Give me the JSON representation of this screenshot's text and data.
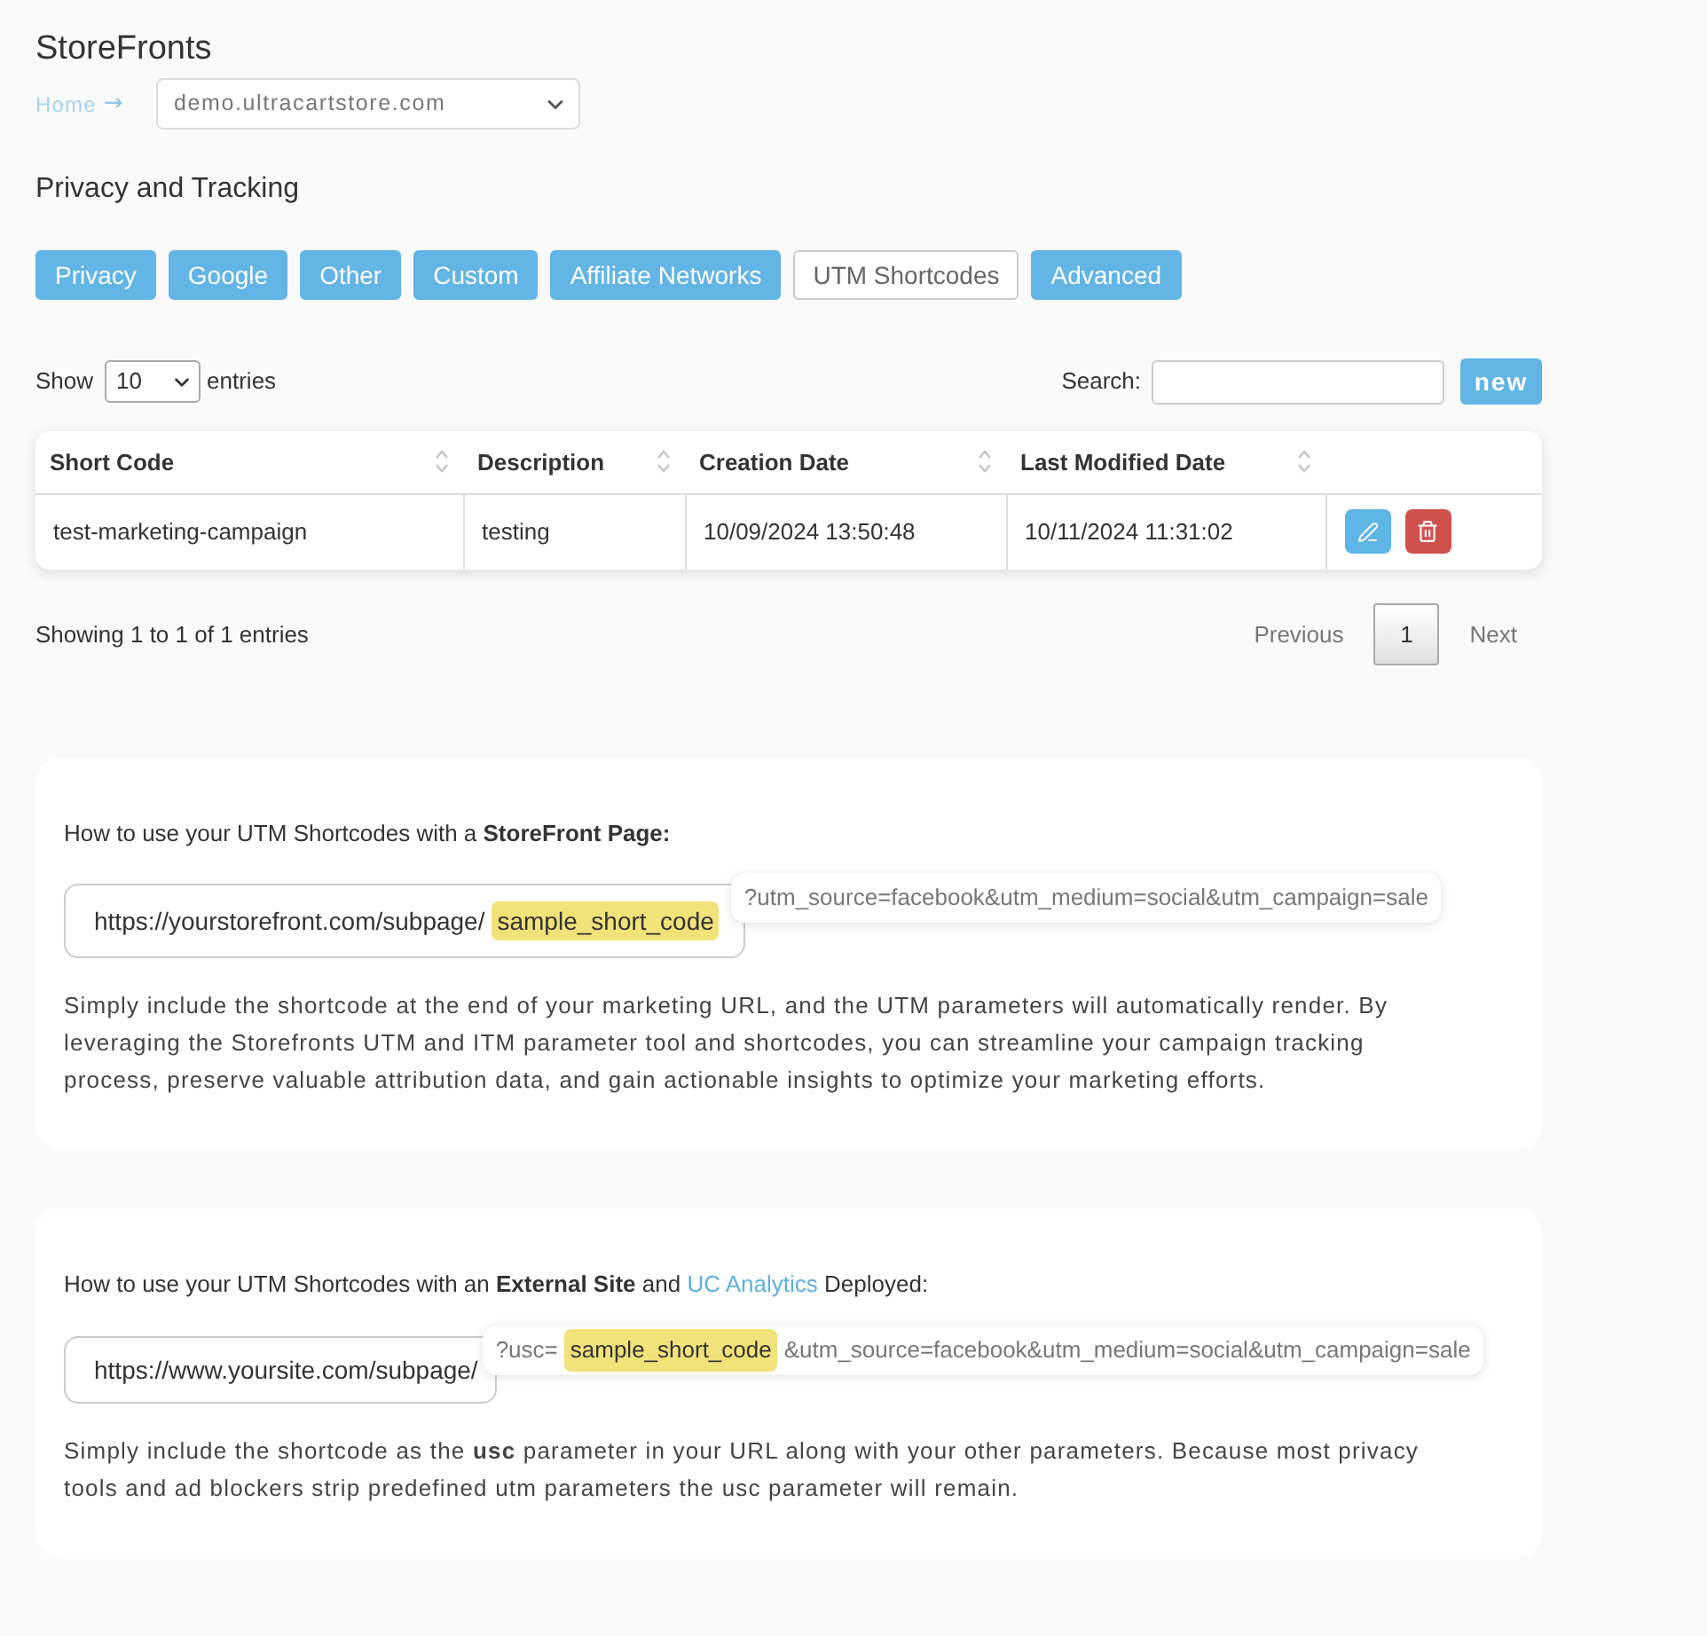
{
  "page": {
    "title": "StoreFronts"
  },
  "breadcrumb": {
    "home": "Home",
    "separator": "→",
    "store_select": {
      "value": "demo.ultracartstore.com"
    }
  },
  "section": {
    "title": "Privacy and Tracking"
  },
  "tabs": [
    {
      "label": "Privacy",
      "selected": false
    },
    {
      "label": "Google",
      "selected": false
    },
    {
      "label": "Other",
      "selected": false
    },
    {
      "label": "Custom",
      "selected": false
    },
    {
      "label": "Affiliate Networks",
      "selected": false
    },
    {
      "label": "UTM Shortcodes",
      "selected": true
    },
    {
      "label": "Advanced",
      "selected": false
    }
  ],
  "table_controls": {
    "show_label": "Show",
    "page_length": "10",
    "entries_label": "entries",
    "search_label": "Search:",
    "new_button": "new"
  },
  "table": {
    "columns": [
      {
        "label": "Short Code",
        "sortable": true
      },
      {
        "label": "Description",
        "sortable": true
      },
      {
        "label": "Creation Date",
        "sortable": true
      },
      {
        "label": "Last Modified Date",
        "sortable": true
      }
    ],
    "rows": [
      {
        "cells": [
          "test-marketing-campaign",
          "testing",
          "10/09/2024 13:50:48",
          "10/11/2024 11:31:02"
        ]
      }
    ]
  },
  "table_info": "Showing 1 to 1 of 1 entries",
  "pagination": {
    "previous": {
      "label": "Previous",
      "disabled": true
    },
    "pages": [
      {
        "label": "1",
        "selected": true
      }
    ],
    "next": {
      "label": "Next",
      "disabled": true
    }
  },
  "cards": [
    {
      "heading": [
        {
          "kind": "text",
          "text": "How to use your UTM Shortcodes with a **StoreFront Page:**"
        }
      ],
      "url_field": {
        "segments": [
          {
            "text": "https://yourstorefront.com/subpage/",
            "highlight": false
          },
          {
            "text": "sample_short_code",
            "highlight": true
          }
        ]
      },
      "parameters": {
        "segments": [
          {
            "text": "?utm_source=facebook&utm_medium=social&utm_campaign=sale",
            "highlight": false
          }
        ]
      },
      "body": "Simply include the shortcode at the end of your marketing URL, and the UTM parameters will automatically render. By leveraging the Storefronts UTM and ITM parameter tool and shortcodes, you can streamline your campaign tracking process, preserve valuable attribution data, and gain actionable insights to optimize your marketing efforts."
    },
    {
      "heading": [
        {
          "kind": "text",
          "text": "How to use your UTM Shortcodes with an **External Site** and"
        },
        {
          "kind": "link",
          "text": "UC Analytics"
        },
        {
          "kind": "text",
          "text": "Deployed:"
        }
      ],
      "url_field": {
        "segments": [
          {
            "text": "https://www.yoursite.com/subpage/",
            "highlight": false
          }
        ]
      },
      "parameters": {
        "segments": [
          {
            "text": "?usc=",
            "highlight": false
          },
          {
            "text": "sample_short_code",
            "highlight": true
          },
          {
            "text": "&utm_source=facebook&utm_medium=social&utm_campaign=sale",
            "highlight": false
          }
        ]
      },
      "body": "Simply include the shortcode as the **usc** parameter in your URL along with your other parameters. Because most privacy tools and ad blockers strip predefined utm parameters the usc parameter will remain."
    }
  ]
}
